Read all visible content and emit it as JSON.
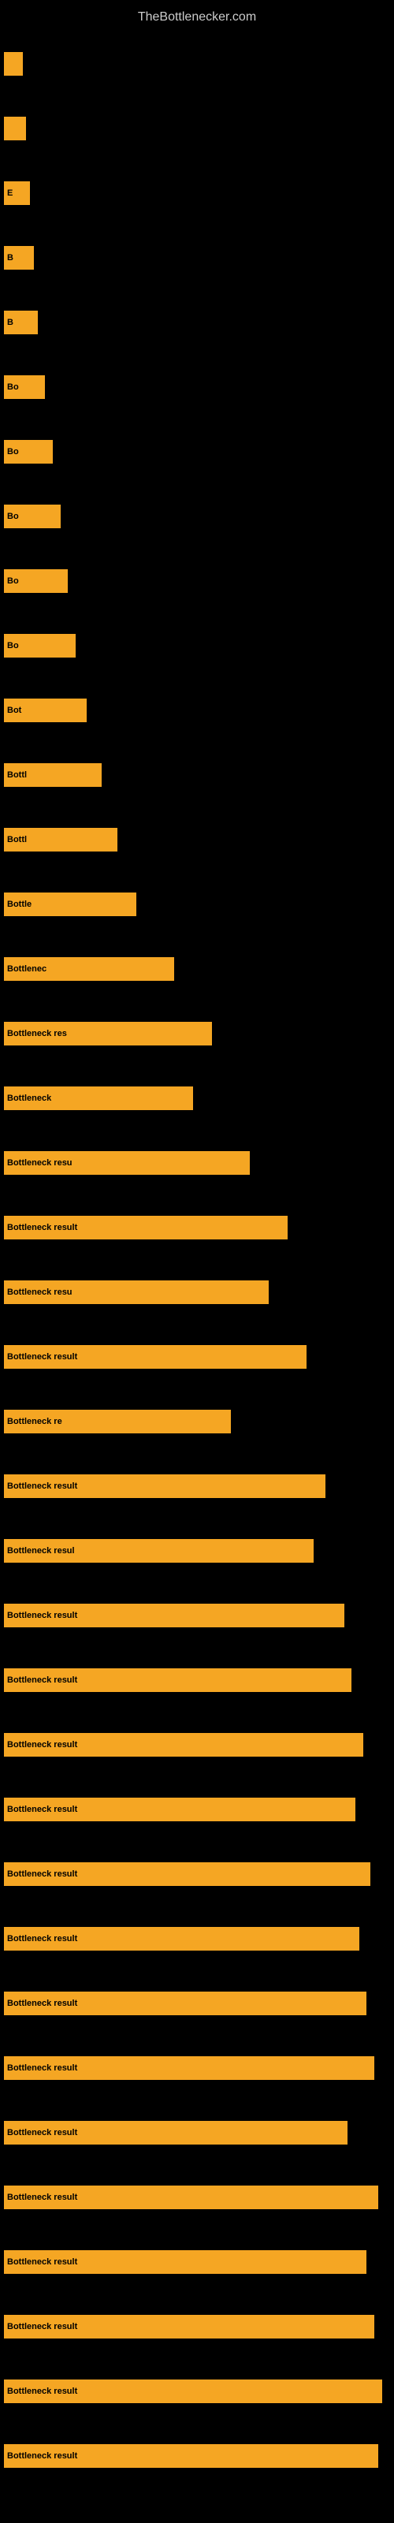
{
  "site": {
    "title": "TheBottlenecker.com"
  },
  "bars": [
    {
      "id": 1,
      "width": 5,
      "label": ""
    },
    {
      "id": 2,
      "width": 6,
      "label": ""
    },
    {
      "id": 3,
      "width": 7,
      "label": "E"
    },
    {
      "id": 4,
      "width": 8,
      "label": "B"
    },
    {
      "id": 5,
      "width": 9,
      "label": "B"
    },
    {
      "id": 6,
      "width": 11,
      "label": "Bo"
    },
    {
      "id": 7,
      "width": 13,
      "label": "Bo"
    },
    {
      "id": 8,
      "width": 15,
      "label": "Bo"
    },
    {
      "id": 9,
      "width": 17,
      "label": "Bo"
    },
    {
      "id": 10,
      "width": 19,
      "label": "Bo"
    },
    {
      "id": 11,
      "width": 22,
      "label": "Bot"
    },
    {
      "id": 12,
      "width": 26,
      "label": "Bottl"
    },
    {
      "id": 13,
      "width": 30,
      "label": "Bottl"
    },
    {
      "id": 14,
      "width": 35,
      "label": "Bottle"
    },
    {
      "id": 15,
      "width": 45,
      "label": "Bottlenec"
    },
    {
      "id": 16,
      "width": 55,
      "label": "Bottleneck res"
    },
    {
      "id": 17,
      "width": 50,
      "label": "Bottleneck"
    },
    {
      "id": 18,
      "width": 65,
      "label": "Bottleneck resu"
    },
    {
      "id": 19,
      "width": 75,
      "label": "Bottleneck result"
    },
    {
      "id": 20,
      "width": 70,
      "label": "Bottleneck resu"
    },
    {
      "id": 21,
      "width": 80,
      "label": "Bottleneck result"
    },
    {
      "id": 22,
      "width": 60,
      "label": "Bottleneck re"
    },
    {
      "id": 23,
      "width": 85,
      "label": "Bottleneck result"
    },
    {
      "id": 24,
      "width": 82,
      "label": "Bottleneck resul"
    },
    {
      "id": 25,
      "width": 90,
      "label": "Bottleneck result"
    },
    {
      "id": 26,
      "width": 92,
      "label": "Bottleneck result"
    },
    {
      "id": 27,
      "width": 95,
      "label": "Bottleneck result"
    },
    {
      "id": 28,
      "width": 93,
      "label": "Bottleneck result"
    },
    {
      "id": 29,
      "width": 97,
      "label": "Bottleneck result"
    },
    {
      "id": 30,
      "width": 94,
      "label": "Bottleneck result"
    },
    {
      "id": 31,
      "width": 96,
      "label": "Bottleneck result"
    },
    {
      "id": 32,
      "width": 98,
      "label": "Bottleneck result"
    },
    {
      "id": 33,
      "width": 91,
      "label": "Bottleneck result"
    },
    {
      "id": 34,
      "width": 99,
      "label": "Bottleneck result"
    },
    {
      "id": 35,
      "width": 96,
      "label": "Bottleneck result"
    },
    {
      "id": 36,
      "width": 98,
      "label": "Bottleneck result"
    },
    {
      "id": 37,
      "width": 100,
      "label": "Bottleneck result"
    },
    {
      "id": 38,
      "width": 99,
      "label": "Bottleneck result"
    }
  ]
}
